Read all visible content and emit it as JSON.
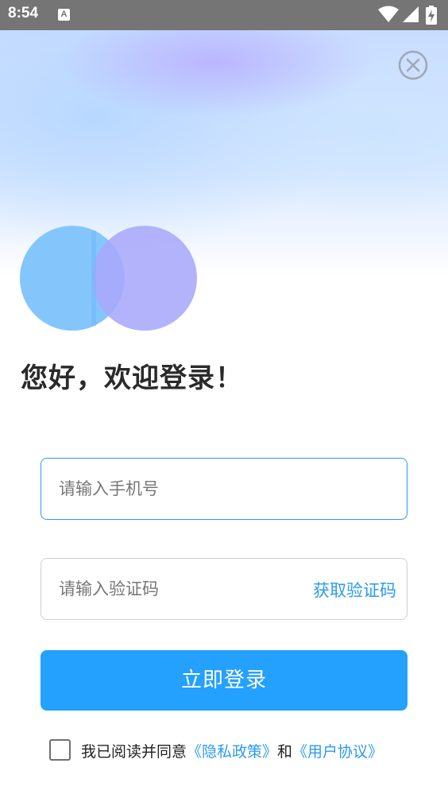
{
  "status_bar": {
    "time": "8:54",
    "notification_icon": "A",
    "icons": [
      "wifi-icon",
      "signal-icon",
      "battery-charging-icon"
    ]
  },
  "header": {
    "close_icon": "close-circle-icon"
  },
  "logo": {
    "colors": [
      "#7ec4fb",
      "#b0b0fa"
    ]
  },
  "title": "您好，欢迎登录！",
  "form": {
    "phone_placeholder": "请输入手机号",
    "code_placeholder": "请输入验证码",
    "get_code_label": "获取验证码",
    "login_label": "立即登录"
  },
  "agreement": {
    "prefix": "我已阅读并同意",
    "privacy_link": "《隐私政策》",
    "connector": "和",
    "terms_link": "《用户协议》",
    "checked": false
  },
  "colors": {
    "accent": "#24a0ff",
    "link": "#2b9af3",
    "status_bar": "#757575"
  }
}
